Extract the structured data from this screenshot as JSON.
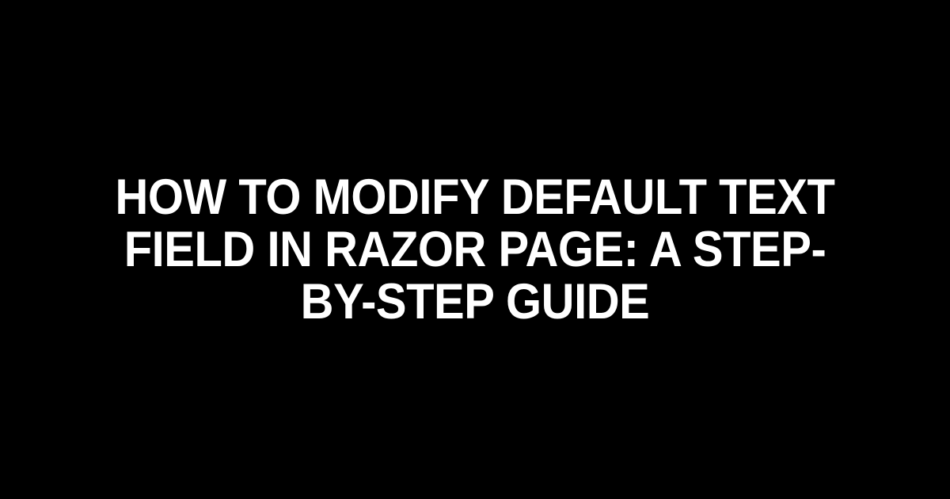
{
  "title": "How to Modify Default Text Field in Razor Page: A Step-by-Step Guide"
}
